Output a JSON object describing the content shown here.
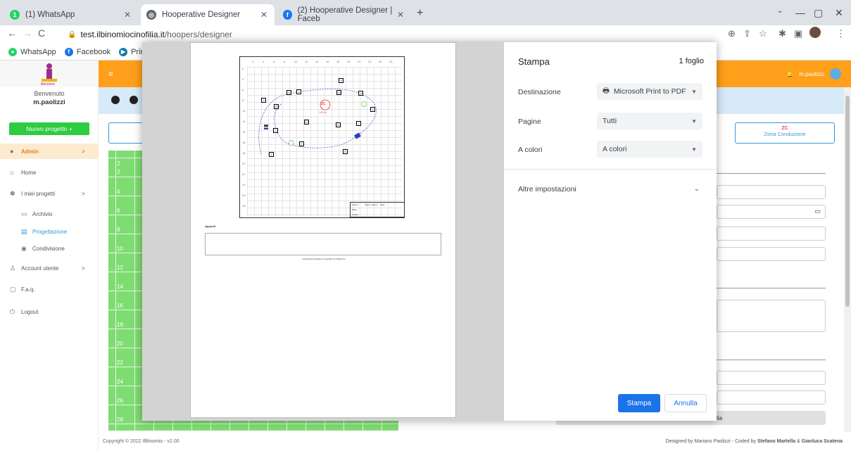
{
  "browser": {
    "tabs": [
      {
        "title": "(1) WhatsApp",
        "icon": "whatsapp-icon",
        "color": "#25d366",
        "badge": "1"
      },
      {
        "title": "Hooperative Designer",
        "icon": "globe-icon",
        "color": "#5f6368"
      },
      {
        "title": "(2) Hooperative Designer | Faceb",
        "icon": "facebook-icon",
        "color": "#1877f2"
      }
    ],
    "url_host": "test.ilbinomiocinofilia.it",
    "url_path": "/hoopers/designer",
    "bookmarks": [
      {
        "label": "WhatsApp",
        "color": "#25d366"
      },
      {
        "label": "Facebook",
        "color": "#1877f2"
      },
      {
        "label": "Prim",
        "color": "#0f79af"
      }
    ]
  },
  "sidebar": {
    "welcome": "Benvenuto",
    "user": "m.paolizzi",
    "new_project": "Nuovo progetto +",
    "items": [
      {
        "label": "Admin",
        "arrow": ">"
      },
      {
        "label": "Home"
      },
      {
        "label": "I miei progetti",
        "arrow": ">"
      },
      {
        "label": "Archivio"
      },
      {
        "label": "Progettazione"
      },
      {
        "label": "Condivisione"
      },
      {
        "label": "Account utente",
        "arrow": ">"
      },
      {
        "label": "F.a.q."
      },
      {
        "label": "Logout"
      }
    ]
  },
  "topbar": {
    "user": "m.paolizzi"
  },
  "zone_card": {
    "badge": "ZC",
    "label": "Zona Conduzione"
  },
  "canvas_ticks": [
    "2",
    "4",
    "6",
    "8",
    "10",
    "12",
    "14",
    "16",
    "18",
    "20",
    "22",
    "24",
    "26",
    "28"
  ],
  "footer": {
    "left": "Copyright © 2022 IlBinomio - v2.00",
    "right_prefix": "Designed by Mariano Paolizzi - Coded by ",
    "right_dev1": "Stefano Martella",
    "right_amp": " & ",
    "right_dev2": "Gianluca Scatena"
  },
  "right_panel_tail": "lia",
  "print_dialog": {
    "title": "Stampa",
    "sheets": "1 foglio",
    "destination_label": "Destinazione",
    "destination_value": "Microsoft Print to PDF",
    "pages_label": "Pagine",
    "pages_value": "Tutti",
    "color_label": "A colori",
    "color_value": "A colori",
    "more_settings": "Altre impostazioni",
    "print_button": "Stampa",
    "cancel_button": "Annulla"
  },
  "preview": {
    "notes_label": "Appunti",
    "copyright": "Hooperative Designer Copyright (c) Il Binomio",
    "zc_label": "ZC",
    "zc_distance": "14.6 m",
    "table_labels": [
      "Autore:",
      "Data:",
      "Livello:"
    ],
    "table_extra": [
      "Superf. allent:",
      "Note:"
    ],
    "x_ticks": [
      "2",
      "4",
      "6",
      "8",
      "10",
      "12",
      "14",
      "16",
      "18",
      "20",
      "22",
      "24",
      "26",
      "28"
    ],
    "y_ticks": [
      "2",
      "4",
      "6",
      "8",
      "10",
      "12",
      "14",
      "16",
      "18",
      "20",
      "22",
      "24",
      "26",
      "28"
    ],
    "obstacles": [
      "1",
      "2",
      "3",
      "4",
      "5",
      "6",
      "7",
      "8",
      "9",
      "10",
      "11",
      "12",
      "13",
      "14",
      "15"
    ]
  }
}
